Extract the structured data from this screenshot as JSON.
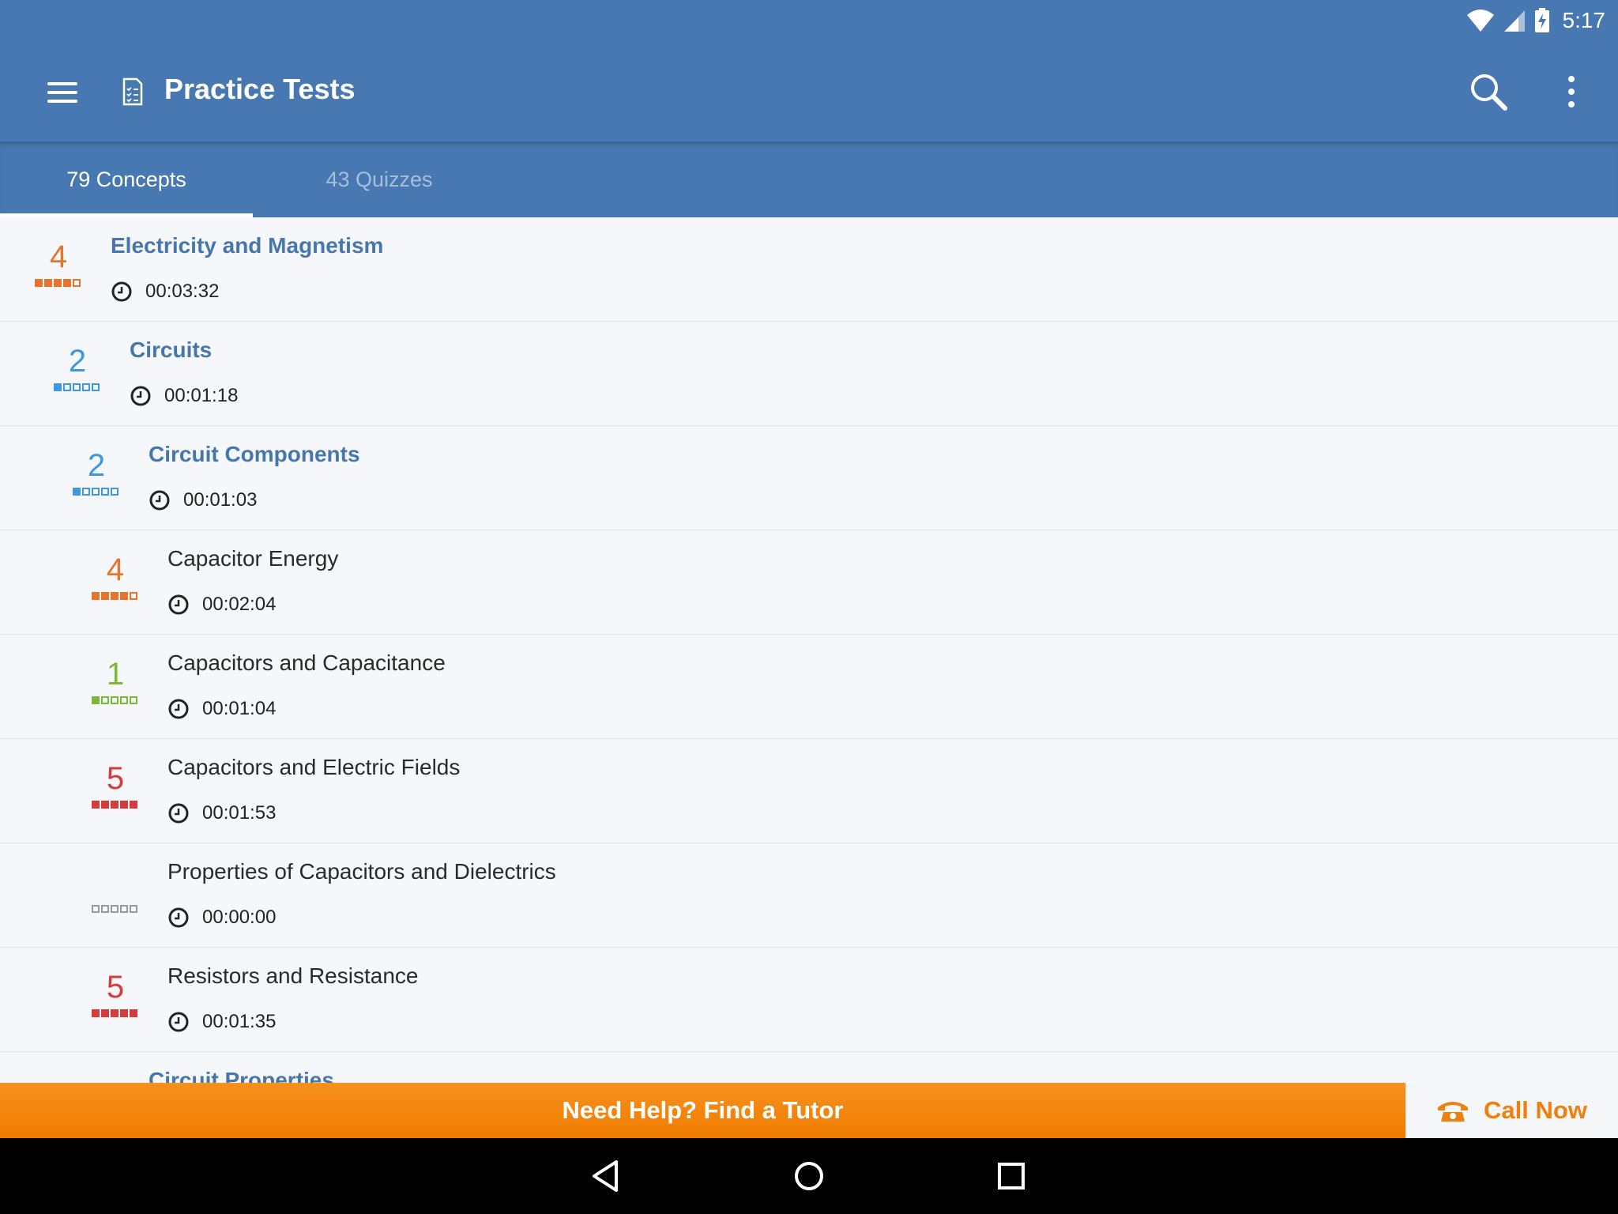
{
  "status_bar": {
    "time": "5:17"
  },
  "toolbar": {
    "title": "Practice Tests"
  },
  "tabs": [
    {
      "label": "79 Concepts",
      "active": true
    },
    {
      "label": "43 Quizzes",
      "active": false
    }
  ],
  "colors": {
    "primary": "#4778b1",
    "orange": "#e8742c",
    "blue": "#3e97e0",
    "green": "#7bb935",
    "red": "#d63a3a",
    "gray": "#9a9a9a",
    "banner": "#f38307"
  },
  "concepts": [
    {
      "name": "Electricity and Magnetism",
      "time": "00:03:32",
      "score": "4",
      "filled": 4,
      "level": 0,
      "group": true,
      "color": "orange"
    },
    {
      "name": "Circuits",
      "time": "00:01:18",
      "score": "2",
      "filled": 1,
      "level": 1,
      "group": true,
      "color": "blue"
    },
    {
      "name": "Circuit Components",
      "time": "00:01:03",
      "score": "2",
      "filled": 1,
      "level": 2,
      "group": true,
      "color": "blue"
    },
    {
      "name": "Capacitor Energy",
      "time": "00:02:04",
      "score": "4",
      "filled": 4,
      "level": 3,
      "group": false,
      "color": "orange"
    },
    {
      "name": "Capacitors and Capacitance",
      "time": "00:01:04",
      "score": "1",
      "filled": 1,
      "level": 3,
      "group": false,
      "color": "green"
    },
    {
      "name": "Capacitors and Electric Fields",
      "time": "00:01:53",
      "score": "5",
      "filled": 5,
      "level": 3,
      "group": false,
      "color": "red"
    },
    {
      "name": "Properties of Capacitors and Dielectrics",
      "time": "00:00:00",
      "score": "",
      "filled": 0,
      "level": 3,
      "group": false,
      "color": "gray"
    },
    {
      "name": "Resistors and Resistance",
      "time": "00:01:35",
      "score": "5",
      "filled": 5,
      "level": 3,
      "group": false,
      "color": "red"
    },
    {
      "name": "Circuit Properties",
      "time": "",
      "score": "",
      "filled": 0,
      "level": 2,
      "group": true,
      "color": "blue",
      "partial": true
    }
  ],
  "banner": {
    "tutor_label": "Need Help? Find a Tutor",
    "call_label": "Call Now"
  }
}
